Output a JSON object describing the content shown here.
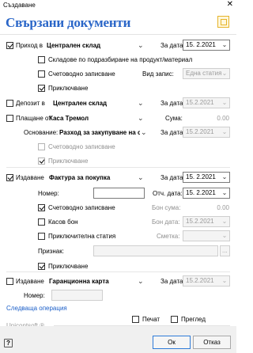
{
  "window": {
    "title": "Създаване",
    "close": "✕"
  },
  "header": {
    "title": "Свързани документи",
    "icon": "document-window-icon"
  },
  "incoming": {
    "label_prefix": "Приход в",
    "warehouse": "Централен склад",
    "date_label": "За дата:",
    "date": "15. 2.2021",
    "opt_by_product": "Складове по подразбиране на продукт/материал",
    "opt_accounting": "Счетоводно записване",
    "type_label": "Вид запис:",
    "type_value": "Една статия",
    "opt_close": "Приключване"
  },
  "deposit": {
    "label_prefix": "Депозит в",
    "warehouse": "Централен склад",
    "date_label": "За дата:",
    "date": "15.2.2021"
  },
  "payment": {
    "label_prefix": "Плащане от",
    "cashbox": "Каса Тремол",
    "sum_label": "Сума:",
    "sum": "0.00",
    "reason_label": "Основание:",
    "reason": "Разход за закупуване на с",
    "date_label": "За дата:",
    "date": "15.2.2021",
    "opt_accounting": "Счетоводно записване",
    "opt_close": "Приключване"
  },
  "invoice": {
    "label_prefix": "Издаване",
    "doc_type": "Фактура за покупка",
    "date_label": "За дата:",
    "date": "15.  2.2021",
    "number_label": "Номер:",
    "number": "",
    "rep_date_label": "Отч. дата:",
    "rep_date": "15.  2.2021",
    "opt_accounting": "Счетоводно записване",
    "bon_sum_label": "Бон сума:",
    "bon_sum": "0.00",
    "opt_cash_receipt": "Касов бон",
    "bon_date_label": "Бон дата:",
    "bon_date": "15.2.2021",
    "opt_close_article": "Приключителна статия",
    "account_label": "Сметка:",
    "account": "",
    "sign_label": "Признак:",
    "sign": "",
    "browse": "...",
    "opt_close": "Приключване"
  },
  "warranty": {
    "label_prefix": "Издаване",
    "doc_type": "Гаранционна карта",
    "date_label": "За дата:",
    "date": "15.2.2021",
    "number_label": "Номер:",
    "number": ""
  },
  "next_operation": "Следваща операция",
  "brand": "Unicontsoft ®",
  "print_label": "Печат",
  "preview_label": "Преглед",
  "ok": "Ок",
  "cancel": "Отказ"
}
